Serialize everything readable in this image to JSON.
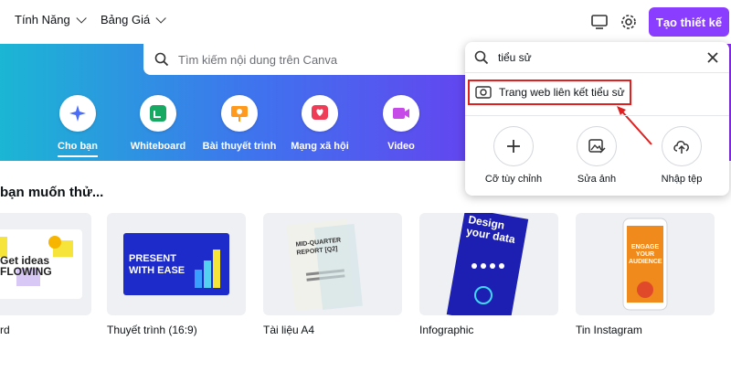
{
  "nav": {
    "features_label": "Tính Năng",
    "pricing_label": "Bảng Giá",
    "create_label": "Tạo thiết kế"
  },
  "hero": {
    "search_placeholder": "Tìm kiếm nội dung trên Canva",
    "categories": [
      {
        "label": "Cho bạn",
        "icon": "sparkle-icon",
        "color": "#4a6cf7"
      },
      {
        "label": "Whiteboard",
        "icon": "whiteboard-icon",
        "color": "#17a862"
      },
      {
        "label": "Bài thuyết trình",
        "icon": "presentation-icon",
        "color": "#ff9a1f"
      },
      {
        "label": "Mạng xã hội",
        "icon": "social-heart-icon",
        "color": "#ef3d57"
      },
      {
        "label": "Video",
        "icon": "video-icon",
        "color": "#c64ae8"
      }
    ]
  },
  "section": {
    "title": "bạn muốn thử...",
    "cards": [
      {
        "label": "rd",
        "thumb_text": "Get ideas FLOWING"
      },
      {
        "label": "Thuyết trình (16:9)",
        "thumb_text": "PRESENT WITH EASE"
      },
      {
        "label": "Tài liệu A4",
        "thumb_text": "MID-QUARTER REPORT [Q2]"
      },
      {
        "label": "Infographic",
        "thumb_text": "Design your data"
      },
      {
        "label": "Tin Instagram",
        "thumb_text": "ENGAGE YOUR AUDIENCE"
      }
    ]
  },
  "popup": {
    "query": "tiểu sử",
    "suggestion": "Trang web liên kết tiểu sử",
    "actions": [
      {
        "label": "Cỡ tùy chỉnh",
        "icon": "plus-icon"
      },
      {
        "label": "Sửa ảnh",
        "icon": "edit-image-icon"
      },
      {
        "label": "Nhập tệp",
        "icon": "upload-cloud-icon"
      }
    ]
  },
  "colors": {
    "brand_purple": "#8b3dff",
    "highlight_red": "#e02020"
  }
}
